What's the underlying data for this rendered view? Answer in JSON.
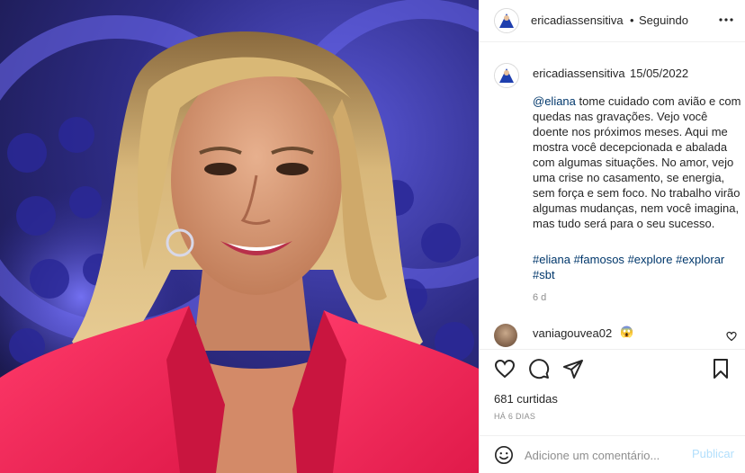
{
  "post": {
    "author": "ericadiassensitiva",
    "separator": "•",
    "follow_status": "Seguindo",
    "caption_date": "15/05/2022",
    "caption_mention": "@eliana",
    "caption_text": " tome cuidado com avião e com quedas nas gravações. Vejo você doente nos próximos meses. Aqui me mostra você decepcionada e abalada com algumas situações. No amor, vejo uma crise no casamento, se energia, sem força e sem foco. No trabalho virão algumas mudanças, nem você imagina, mas tudo será para o seu sucesso.",
    "hashtags": [
      "#eliana",
      "#famosos",
      "#explore",
      "#explorar",
      "#sbt"
    ],
    "caption_age": "6 d",
    "likes": "681 curtidas",
    "posted_ago": "HÁ 6 DIAS"
  },
  "comments": [
    {
      "user": "vaniagouvea02",
      "text": "😱"
    }
  ],
  "add_comment": {
    "placeholder": "Adicione um comentário...",
    "publish_label": "Publicar"
  },
  "colors": {
    "link": "#00376b",
    "muted": "#8e8e8e",
    "publish_disabled": "#b2dffc",
    "jacket": "#f5245a"
  },
  "icons": {
    "more": "more-options-icon",
    "heart": "heart-icon",
    "comment": "comment-icon",
    "share": "share-icon",
    "save": "bookmark-icon",
    "emoji": "emoji-icon"
  }
}
